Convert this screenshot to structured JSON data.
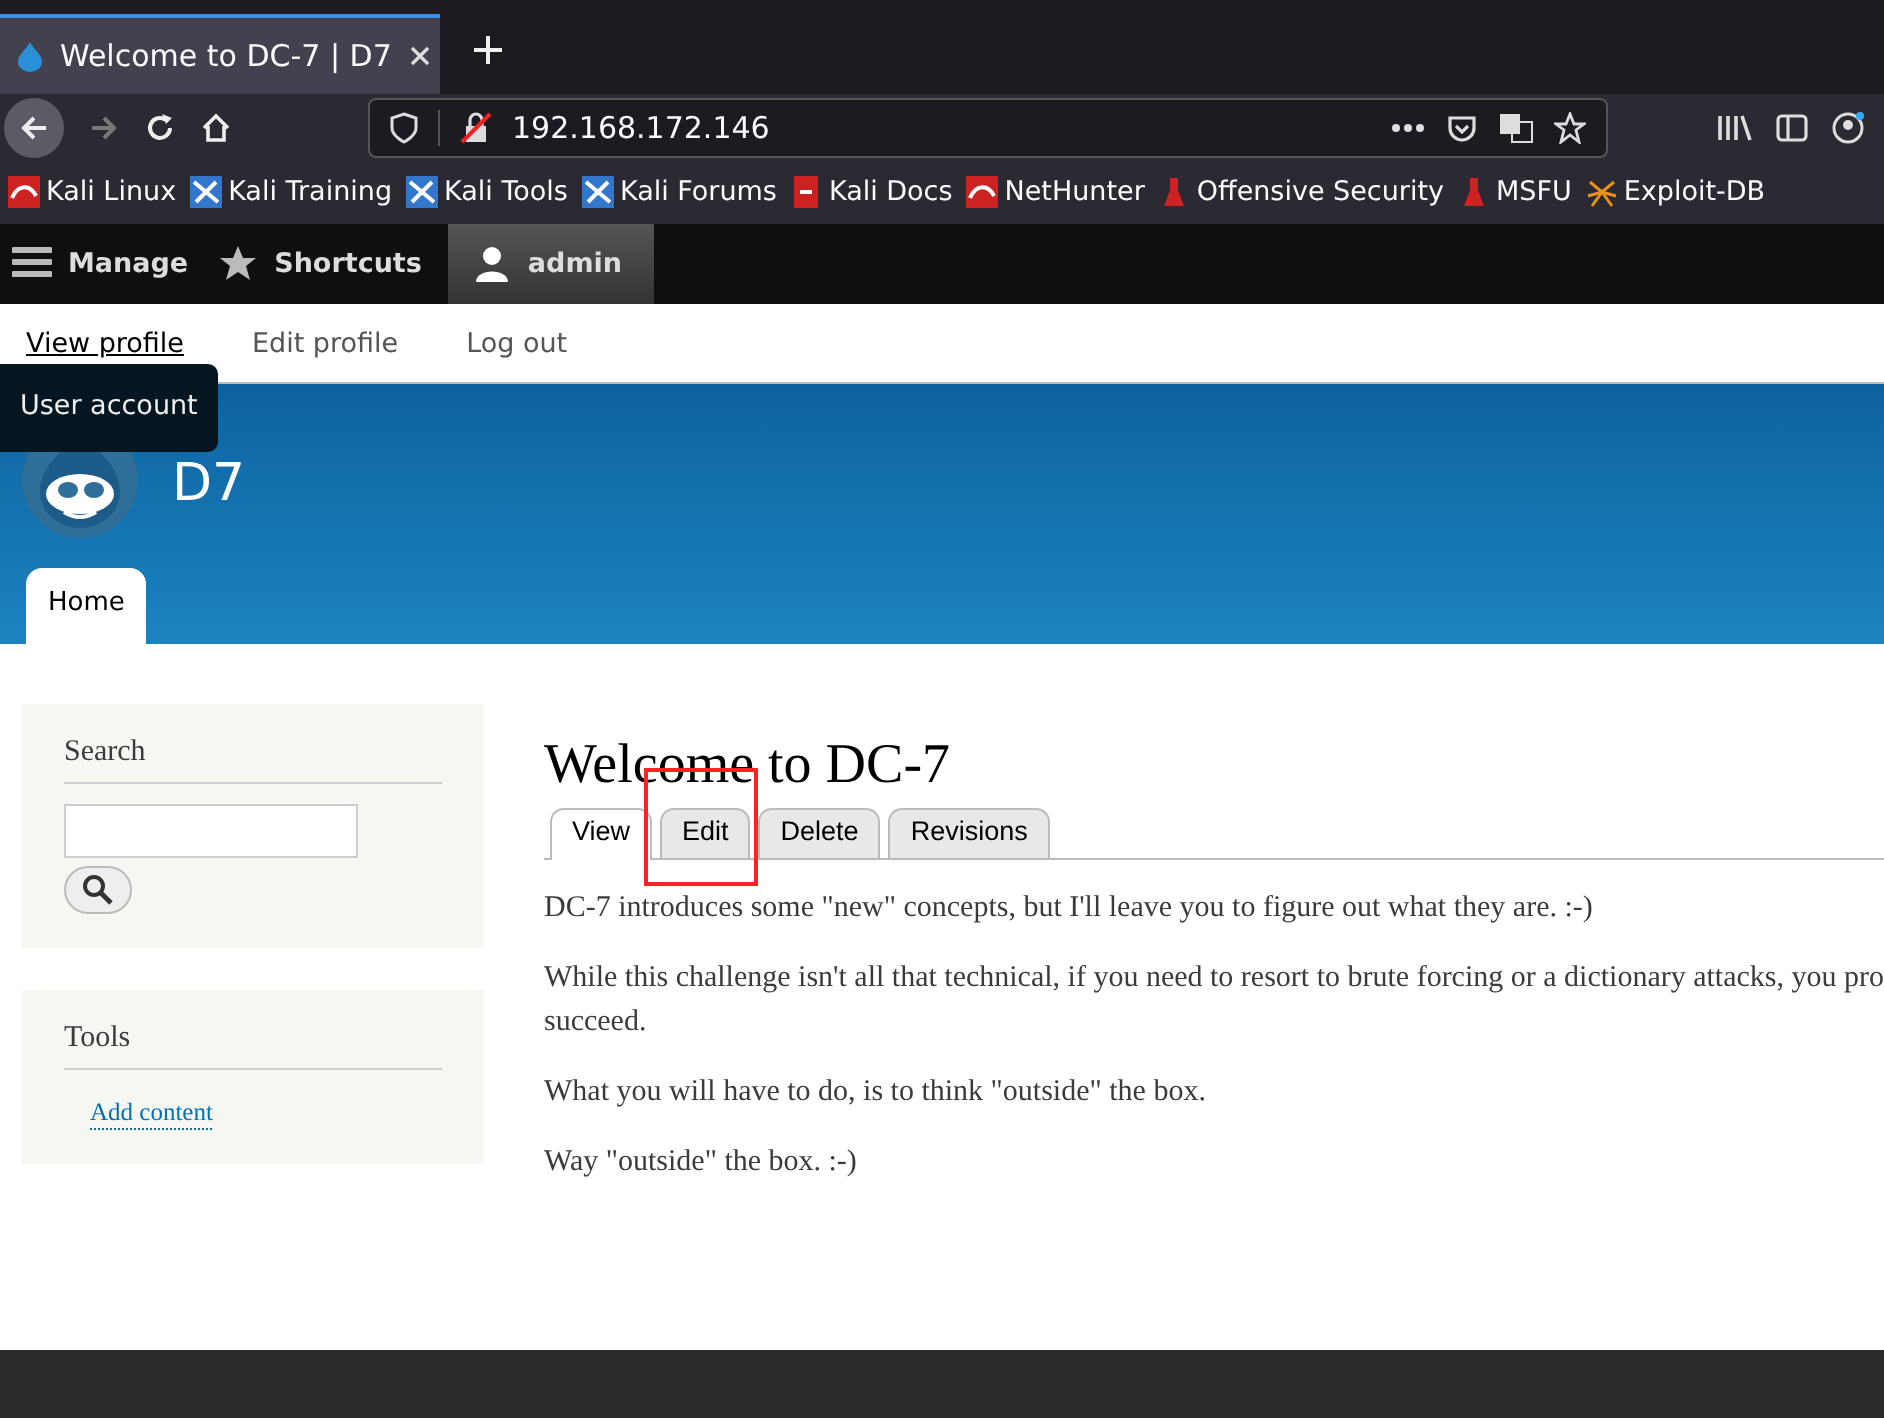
{
  "browser": {
    "tab_title": "Welcome to DC-7 | D7",
    "url": "192.168.172.146",
    "bookmarks": [
      {
        "label": "Kali Linux",
        "kind": "kali"
      },
      {
        "label": "Kali Training",
        "kind": "tool"
      },
      {
        "label": "Kali Tools",
        "kind": "tool"
      },
      {
        "label": "Kali Forums",
        "kind": "tool"
      },
      {
        "label": "Kali Docs",
        "kind": "docs"
      },
      {
        "label": "NetHunter",
        "kind": "kali"
      },
      {
        "label": "Offensive Security",
        "kind": "flask"
      },
      {
        "label": "MSFU",
        "kind": "flask"
      },
      {
        "label": "Exploit-DB",
        "kind": "spider"
      }
    ]
  },
  "toolbar": {
    "items": [
      {
        "label": "Manage",
        "kind": "menu",
        "selected": false
      },
      {
        "label": "Shortcuts",
        "kind": "star",
        "selected": false
      },
      {
        "label": "admin",
        "kind": "user",
        "selected": true
      }
    ],
    "tray": [
      {
        "label": "View profile",
        "selected": true
      },
      {
        "label": "Edit profile",
        "selected": false
      },
      {
        "label": "Log out",
        "selected": false
      }
    ],
    "tooltip": "User account"
  },
  "site": {
    "name": "D7",
    "nav": [
      {
        "label": "Home",
        "selected": true
      }
    ]
  },
  "sidebar": {
    "blocks": [
      {
        "title": "Search",
        "kind": "search"
      },
      {
        "title": "Tools",
        "kind": "links",
        "links": [
          "Add content"
        ]
      }
    ]
  },
  "content": {
    "title": "Welcome to DC-7",
    "tabs": [
      {
        "label": "View",
        "selected": true,
        "highlighted": false
      },
      {
        "label": "Edit",
        "selected": false,
        "highlighted": true
      },
      {
        "label": "Delete",
        "selected": false,
        "highlighted": false
      },
      {
        "label": "Revisions",
        "selected": false,
        "highlighted": false
      }
    ],
    "paragraphs": [
      [
        "DC-7 introduces some \"new\" concepts, but I'll leave you to figure out what they are.  :-)"
      ],
      [
        "While this challenge isn't all that technical, if you need to resort to brute forcing or a dictionary attacks, you pro",
        "succeed."
      ],
      [
        "What you will have to do, is to think \"outside\" the box."
      ],
      [
        "Way \"outside\" the box.  :-)"
      ]
    ]
  }
}
